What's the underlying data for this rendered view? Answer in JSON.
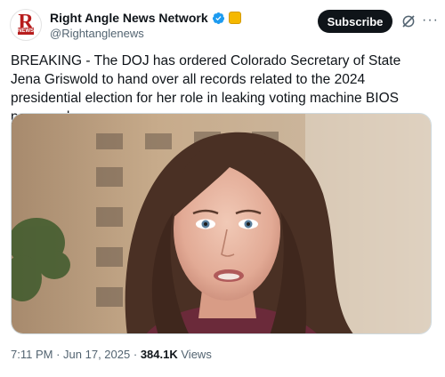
{
  "author": {
    "display_name": "Right Angle News Network",
    "handle": "@Rightanglenews",
    "avatar_letter": "R",
    "avatar_sub": "NEWS"
  },
  "actions": {
    "subscribe_label": "Subscribe",
    "more_label": "···"
  },
  "tweet": {
    "text": "BREAKING - The DOJ has ordered Colorado Secretary of State Jena Griswold to hand over all records related to the 2024 presidential election for her role in leaking voting machine BIOS passwords."
  },
  "meta": {
    "time": "7:11 PM",
    "separator": "·",
    "date": "Jun 17, 2025",
    "views_count": "384.1K",
    "views_label": "Views"
  },
  "colors": {
    "accent_dark": "#0f1419",
    "muted": "#536471",
    "verified_blue": "#1d9bf0",
    "affiliate_gold": "#f5b800",
    "brand_red": "#b71c1c"
  }
}
